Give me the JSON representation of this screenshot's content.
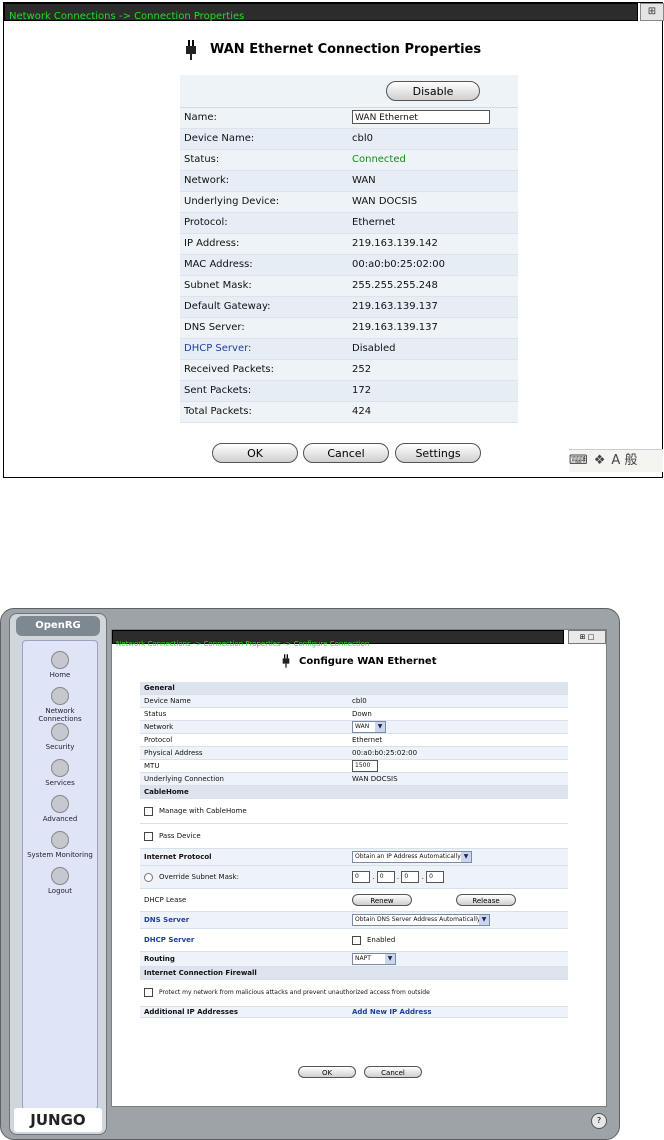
{
  "top": {
    "breadcrumb": "Network Connections -> Connection Properties",
    "corner_icon": "network-icon",
    "title": "WAN Ethernet Connection Properties",
    "disable_label": "Disable",
    "name_label": "Name:",
    "name_value": "WAN Ethernet",
    "rows": [
      {
        "label": "Device Name:",
        "value": "cbl0"
      },
      {
        "label": "Status:",
        "value": "Connected"
      },
      {
        "label": "Network:",
        "value": "WAN"
      },
      {
        "label": "Underlying Device:",
        "value": "WAN DOCSIS"
      },
      {
        "label": "Protocol:",
        "value": "Ethernet"
      },
      {
        "label": "IP Address:",
        "value": "219.163.139.142"
      },
      {
        "label": "MAC Address:",
        "value": "00:a0:b0:25:02:00"
      },
      {
        "label": "Subnet Mask:",
        "value": "255.255.255.248"
      },
      {
        "label": "Default Gateway:",
        "value": "219.163.139.137"
      },
      {
        "label": "DNS Server:",
        "value": "219.163.139.137"
      },
      {
        "label": "DHCP Server:",
        "value": "Disabled"
      },
      {
        "label": "Received Packets:",
        "value": "252"
      },
      {
        "label": "Sent Packets:",
        "value": "172"
      },
      {
        "label": "Total Packets:",
        "value": "424"
      }
    ],
    "buttons": {
      "ok": "OK",
      "cancel": "Cancel",
      "settings": "Settings"
    },
    "tray": {
      "ime_text": "A 般"
    }
  },
  "bottom": {
    "brand": "OpenRG",
    "vendor": "JUNGO",
    "breadcrumb": "Network Connections -> Connection Properties -> Configure Connection",
    "title": "Configure WAN Ethernet",
    "nav": [
      "Home",
      "Network Connections",
      "Security",
      "Services",
      "Advanced",
      "System Monitoring",
      "Logout"
    ],
    "general_header": "General",
    "general_rows": [
      {
        "label": "Device Name",
        "value": "cbl0"
      },
      {
        "label": "Status",
        "value": "Down"
      },
      {
        "label": "Network",
        "value": "WAN"
      },
      {
        "label": "Protocol",
        "value": "Ethernet"
      },
      {
        "label": "Physical Address",
        "value": "00:a0:b0:25:02:00"
      },
      {
        "label": "MTU",
        "value": "1500"
      },
      {
        "label": "Underlying Connection",
        "value": "WAN DOCSIS"
      }
    ],
    "cablehome_header": "CableHome",
    "manage_label": "Manage with CableHome",
    "pass_label": "Pass Device",
    "internet_protocol_label": "Internet Protocol",
    "internet_protocol_value": "Obtain an IP Address Automatically",
    "override_label": "Override Subnet Mask:",
    "mask_octets": [
      "0",
      "0",
      "0",
      "0"
    ],
    "dhcp_lease_label": "DHCP Lease",
    "renew_label": "Renew",
    "release_label": "Release",
    "dns_label": "DNS Server",
    "dns_value": "Obtain DNS Server Address Automatically",
    "dhcp_server_label": "DHCP Server",
    "dhcp_enabled_label": "Enabled",
    "routing_label": "Routing",
    "routing_value": "NAPT",
    "firewall_header": "Internet Connection Firewall",
    "firewall_label": "Protect my network from malicious attacks and prevent unauthorized access from outside",
    "addl_ip_label": "Additional IP Addresses",
    "addl_ip_link": "Add New IP Address",
    "ok_label": "OK",
    "cancel_label": "Cancel",
    "help_icon": "help-icon"
  }
}
